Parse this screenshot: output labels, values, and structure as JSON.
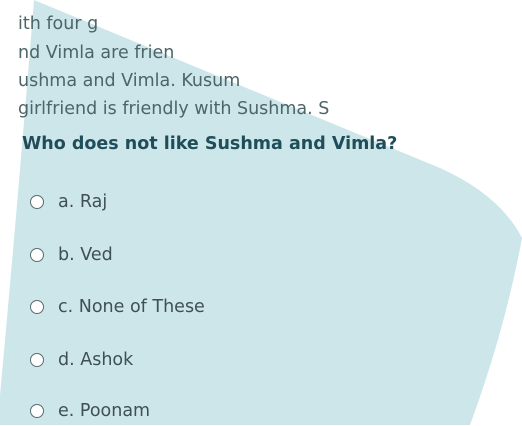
{
  "passage": {
    "lines": [
      "ith four g",
      "nd Vimla are frien",
      "ushma and Vimla. Kusum",
      "girlfriend is friendly with Sushma. S"
    ]
  },
  "question": "Who does not like Sushma and Vimla?",
  "options": [
    {
      "label": "a. Raj"
    },
    {
      "label": "b. Ved"
    },
    {
      "label": "c. None of These"
    },
    {
      "label": "d. Ashok"
    },
    {
      "label": "e. Poonam"
    }
  ],
  "colors": {
    "card": "#cde6ea",
    "question_text": "#1f4e5a",
    "body_text": "#3f4f54"
  }
}
